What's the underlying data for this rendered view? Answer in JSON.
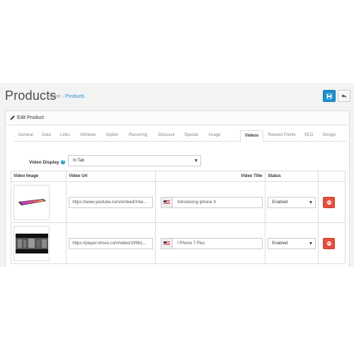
{
  "header": {
    "title": "Products",
    "breadcrumb": {
      "home": "Home",
      "separator": "›",
      "current": "Products"
    },
    "save_icon": "floppy-disk-icon",
    "back_icon": "reply-arrow-icon"
  },
  "panel": {
    "title": "Edit Product",
    "icon": "pencil-icon"
  },
  "tabs": [
    {
      "label": "General"
    },
    {
      "label": "Data"
    },
    {
      "label": "Links"
    },
    {
      "label": "Attribute"
    },
    {
      "label": "Option"
    },
    {
      "label": "Recurring"
    },
    {
      "label": "Discount"
    },
    {
      "label": "Special"
    },
    {
      "label": "Image"
    },
    {
      "label": "Videos",
      "active": true
    },
    {
      "label": "Reward Points"
    },
    {
      "label": "SEO"
    },
    {
      "label": "Design"
    }
  ],
  "video_display": {
    "label": "Video Display",
    "value": "In Tab"
  },
  "table": {
    "headers": {
      "image": "Video Image",
      "url": "Video Url",
      "title": "Video Title",
      "status": "Status"
    },
    "rows": [
      {
        "url": "https://www.youtube.com/embed/X4w...",
        "title": "Introducing iphone X",
        "status": "Enabled"
      },
      {
        "url": "https://player.vimeo.com/video/19961...",
        "title": "I Phone 7 Plus",
        "status": "Enabled"
      }
    ]
  },
  "colors": {
    "primary": "#1e91cf",
    "danger": "#e3503e",
    "background": "#f3f3f3"
  }
}
